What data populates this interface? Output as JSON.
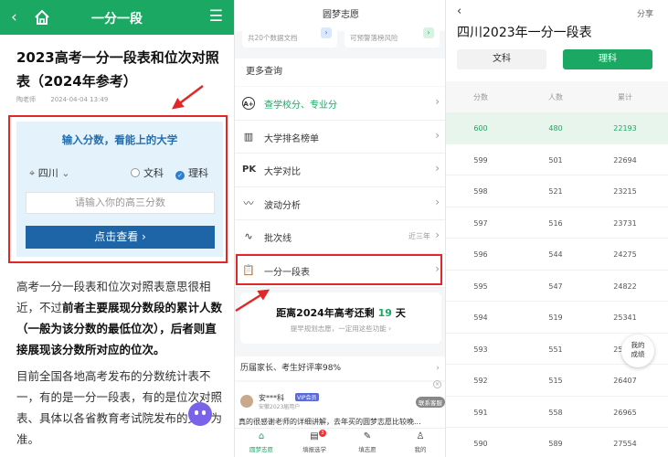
{
  "article": {
    "topbar_title": "一分一段",
    "title": "2023高考一分一段表和位次对照表（2024年参考）",
    "author": "陶老师",
    "date": "2024-04-04 13:49",
    "lookup": {
      "heading": "输入分数，看能上的大学",
      "province": "四川",
      "option_wen": "文科",
      "option_li": "理科",
      "score_placeholder": "请输入你的高三分数",
      "submit_label": "点击查看 ›"
    },
    "para1_a": "高考一分一段表和位次对照表意思很相近，不过",
    "para1_b": "前者主要展现分数段的累计人数（一般为该分数的最低位次），后者则直接展现该分数所对应的位次。",
    "para2": "目前全国各地高考发布的分数统计表不一，有的是一分一段表，有的是位次对照表、具体以各省教育考试院发布的文件为准。"
  },
  "app": {
    "title": "圆梦志愿",
    "card_left": "共20个数据文档",
    "card_right": "可预警落榜风险",
    "more_title": "更多查询",
    "items": [
      {
        "label": "查学校分、专业分",
        "right": ""
      },
      {
        "label": "大学排名榜单",
        "right": ""
      },
      {
        "label": "大学对比",
        "right": ""
      },
      {
        "label": "波动分析",
        "right": ""
      },
      {
        "label": "批次线",
        "right": "近三年"
      },
      {
        "label": "一分一段表",
        "right": ""
      }
    ],
    "countdown_a": "距离2024年高考还剩",
    "countdown_num": "19",
    "countdown_b": "天",
    "countdown_sub": "提早规划志愿，一定用这些功能 ›",
    "review_head": "历届家长、考生好评率98%",
    "review_name": "安***科",
    "review_vip": "VIP会员",
    "review_sub": "安徽2023届用户",
    "review_consult": "联系客服",
    "review_text": "真的很感谢老师的详细讲解，去年买的圆梦志愿比较晚...",
    "tabs": [
      {
        "label": "圆梦志愿"
      },
      {
        "label": "填报选学",
        "badge": "3"
      },
      {
        "label": "填志愿"
      },
      {
        "label": "我的"
      }
    ]
  },
  "table_page": {
    "share": "分享",
    "title": "四川2023年一分一段表",
    "seg_wen": "文科",
    "seg_li": "理科",
    "headers": [
      "分数",
      "人数",
      "累计"
    ],
    "rows": [
      [
        "600",
        "480",
        "22193"
      ],
      [
        "599",
        "501",
        "22694"
      ],
      [
        "598",
        "521",
        "23215"
      ],
      [
        "597",
        "516",
        "23731"
      ],
      [
        "596",
        "544",
        "24275"
      ],
      [
        "595",
        "547",
        "24822"
      ],
      [
        "594",
        "519",
        "25341"
      ],
      [
        "593",
        "551",
        "25892"
      ],
      [
        "592",
        "515",
        "26407"
      ],
      [
        "591",
        "558",
        "26965"
      ],
      [
        "590",
        "589",
        "27554"
      ]
    ],
    "grade_bubble_a": "我的",
    "grade_bubble_b": "成绩"
  }
}
